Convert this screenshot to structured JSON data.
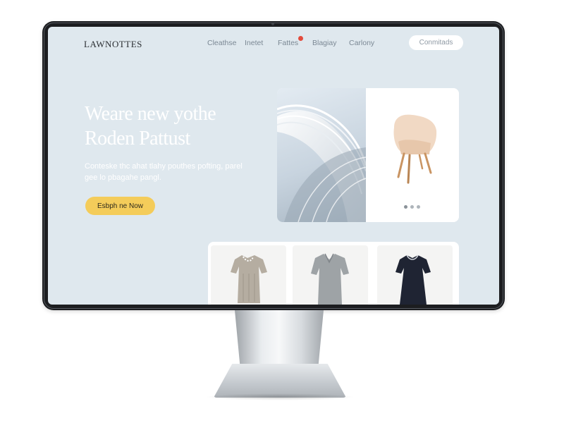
{
  "site": {
    "logo": "LAWNOTTES"
  },
  "nav": {
    "items": [
      {
        "label": "Cleathse"
      },
      {
        "label": "Inetet"
      },
      {
        "label": "Fattes",
        "has_notification": true
      },
      {
        "label": "Blagiay"
      },
      {
        "label": "Carlony"
      }
    ],
    "cta_label": "Conmitads"
  },
  "hero": {
    "title": "Weare new yothe Roden Pattust",
    "subtitle": "Conteske thc ahat tlahy pouthes pofting, parel gee lo pbagahe pangl.",
    "button_label": "Esbph ne Now"
  },
  "gallery": {
    "dots": 3,
    "active_dot": 0
  },
  "products": [
    {
      "icon": "beige-dress-icon",
      "color": "#b5ada1"
    },
    {
      "icon": "gray-dress-icon",
      "color": "#9ea3a6"
    },
    {
      "icon": "navy-dress-icon",
      "color": "#1f2433"
    }
  ],
  "colors": {
    "screen_bg": "#dfe8ee",
    "accent_button": "#f4cc5a",
    "notification": "#e34b3c"
  }
}
